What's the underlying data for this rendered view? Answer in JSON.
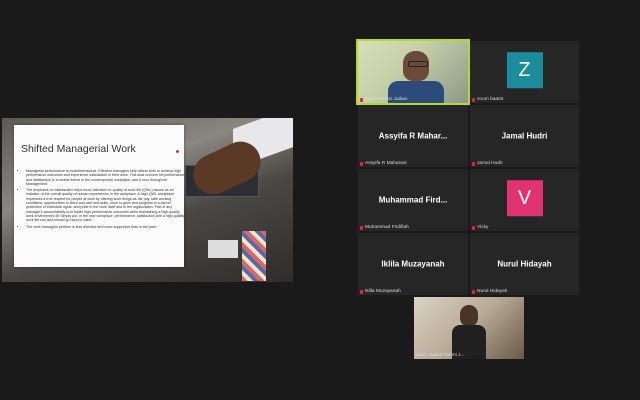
{
  "slide": {
    "title": "Shifted Managerial Work",
    "bullets": [
      "Managerial performance is multidimensional. Effective managers help others both to achieve high performance outcomes and experience satisfaction in their work. This dual concern for performance and satisfaction is a central theme in the contemporary workplace, and it runs throughout Management.",
      "The emphasis on satisfaction helps focus attention on quality of work life (QWL) issues as an indicator of the overall quality of human experiences in the workplace. A high-QWL workplace expresses a true respect for people at work by offering such things as fair pay, safe working conditions, opportunities to learn and use new skills, room to grow and progress in a career, protection of individual rights, and pride in the work itself and in the organization. Part of any manager's accountability is to foster high-performance outcomes while maintaining a high-quality work environment.56 Simply put, in the new workplace, performance, satisfaction and a high-quality work life can and should go hand in hand.",
      "The work managers perform is less directive and more supportive than in the past."
    ]
  },
  "participants": {
    "zakiul": {
      "label": "Zakiul Fahmi Jailani"
    },
    "zoom": {
      "letter": "Z",
      "label": "zoom baa04",
      "color": "#1c8c9c"
    },
    "assyifa": {
      "display": "Assyifa R Mahar...",
      "label": "Assyifa R Maharani"
    },
    "jamal": {
      "display": "Jamal Hudri",
      "label": "Jamal Hudri"
    },
    "muhammad": {
      "display": "Muhammad Fird...",
      "label": "Muhammad Firdifiah"
    },
    "vicky": {
      "letter": "V",
      "label": "Vicky",
      "color": "#e0336f"
    },
    "iklila": {
      "display": "Iklila Muzayanah",
      "label": "Iklila Muzayanah"
    },
    "nurul": {
      "display": "Nurul Hidayah",
      "label": "Nurul Hidayah"
    },
    "zaki": {
      "label": "Zaki - Zakiul Fahmi J..."
    }
  }
}
